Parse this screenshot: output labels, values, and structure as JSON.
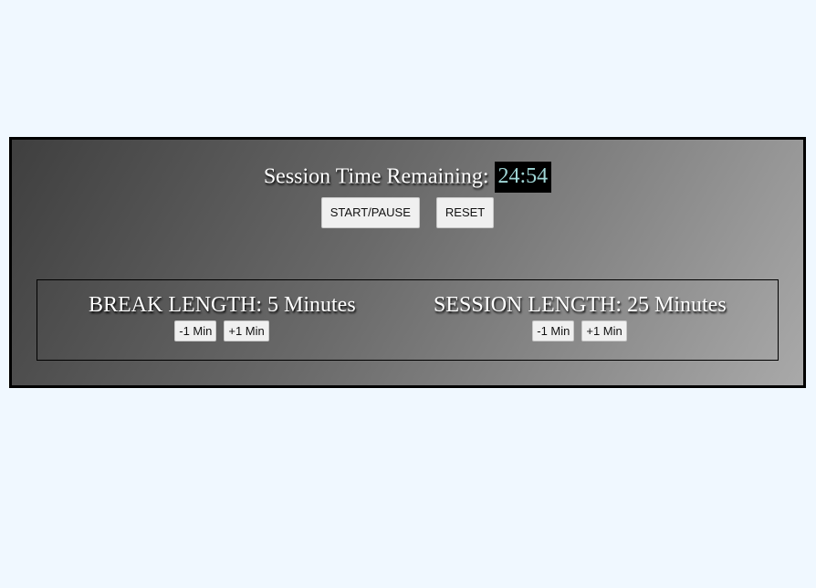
{
  "session": {
    "label": "Session Time Remaining:",
    "time": "24:54"
  },
  "controls": {
    "start_pause_label": "START/PAUSE",
    "reset_label": "RESET"
  },
  "break_length": {
    "title": "BREAK LENGTH: 5 Minutes",
    "decrement_label": "-1 Min",
    "increment_label": "+1 Min"
  },
  "session_length": {
    "title": "SESSION LENGTH: 25 Minutes",
    "decrement_label": "-1 Min",
    "increment_label": "+1 Min"
  },
  "colors": {
    "page_background": "#f0f8ff",
    "time_text": "#9fd6d6",
    "time_background": "#000000"
  }
}
